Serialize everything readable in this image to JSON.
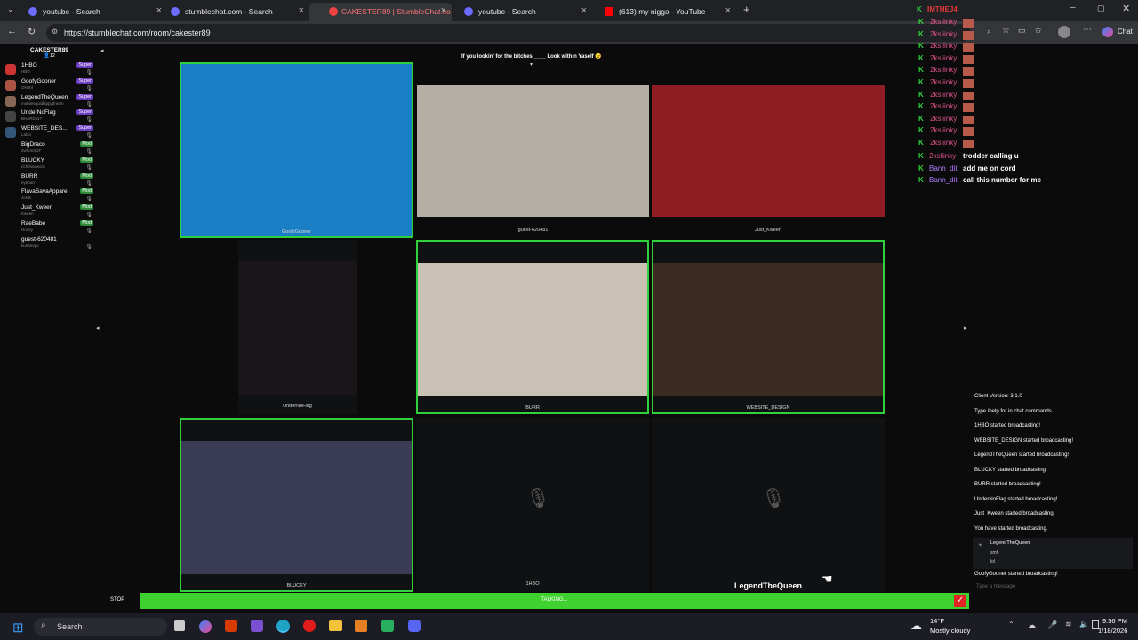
{
  "browser": {
    "tabs": [
      {
        "title": "youtube - Search",
        "fav": "#6c6cff"
      },
      {
        "title": "stumblechat.com - Search",
        "fav": "#6c6cff"
      },
      {
        "title": "CAKESTER89 | StumbleChat.co",
        "fav": "#e44"
      },
      {
        "title": "youtube - Search",
        "fav": "#6c6cff"
      },
      {
        "title": "(613) my nigga - YouTube",
        "fav": "#f00"
      }
    ],
    "url": "https://stumblechat.com/room/cakester89",
    "chat_button": "Chat"
  },
  "room": {
    "name": "CAKESTER89",
    "count": "12",
    "topic": "If you lookin' for the bitches ____ Look within Yaself 😉"
  },
  "users": [
    {
      "name": "1HBO",
      "sub": "HBO",
      "badge": "Super",
      "type": "super",
      "icon": "#c33"
    },
    {
      "name": "GoofyGooner",
      "sub": "ONIIIII",
      "badge": "Super",
      "type": "super",
      "icon": "#a54"
    },
    {
      "name": "LegendTheQueen",
      "sub": "mobilesquidhippydream",
      "badge": "Super",
      "type": "super",
      "icon": "#865"
    },
    {
      "name": "UnderNoFlag",
      "sub": "BHARD117",
      "badge": "Super",
      "type": "super",
      "icon": "#444"
    },
    {
      "name": "WEBSITE_DES...",
      "sub": "LaDa",
      "badge": "Super",
      "type": "super",
      "icon": "#357"
    },
    {
      "name": "BigDraco",
      "sub": "2whore$2F",
      "badge": "Mod",
      "type": "mod",
      "icon": ""
    },
    {
      "name": "BLUCKY",
      "sub": "richthisaword",
      "badge": "Mod",
      "type": "mod",
      "icon": ""
    },
    {
      "name": "BURR",
      "sub": "eyeburr",
      "badge": "Mod",
      "type": "mod",
      "icon": ""
    },
    {
      "name": "FlavaSavaApparel",
      "sub": "Jords",
      "badge": "Mod",
      "type": "mod",
      "icon": ""
    },
    {
      "name": "Just_Kween",
      "sub": "Kween",
      "badge": "Mod",
      "type": "mod",
      "icon": ""
    },
    {
      "name": "RaeBabe",
      "sub": "Honey",
      "badge": "Mod",
      "type": "mod",
      "icon": ""
    },
    {
      "name": "guest-620481",
      "sub": "kurlamqlo",
      "badge": "",
      "type": "",
      "icon": ""
    }
  ],
  "tiles": [
    {
      "label": "GoofyGooner",
      "on": true,
      "bg": "#1a7fc4",
      "mic": false
    },
    {
      "label": "guest-620481",
      "on": false,
      "bg": "#b4aea4",
      "mic": false
    },
    {
      "label": "Just_Kween",
      "on": false,
      "bg": "#8e1c22",
      "mic": false
    },
    {
      "label": "UnderNoFlag",
      "on": false,
      "bg": "#1a1518",
      "mic": false
    },
    {
      "label": "BURR",
      "on": true,
      "bg": "#c9c2b4",
      "mic": false
    },
    {
      "label": "WEBSITE_DESIGN",
      "on": true,
      "bg": "#3a2a22",
      "mic": false
    },
    {
      "label": "BLUCKY",
      "on": true,
      "bg": "#3a3c56",
      "mic": false
    },
    {
      "label": "1HBO",
      "on": false,
      "bg": "#0f1113",
      "mic": true
    },
    {
      "label": "LegendTheQueen",
      "on": false,
      "bg": "#0f1113",
      "mic": true
    }
  ],
  "overlay": {
    "header": "IMTHEJ4",
    "spam_name": "2ksliinky",
    "lines": [
      {
        "name": "2ksliinky",
        "text": "trodder calling u"
      },
      {
        "name": "Bann_dit",
        "text": "add me on cord"
      },
      {
        "name": "Bann_dit",
        "text": "call this number for me"
      }
    ]
  },
  "chat_log": {
    "messages": [
      "Client Version: 3.1.0",
      "Type /help for in chat commands.",
      "1HBO started broadcasting!",
      "WEBSITE_DESIGN started broadcasting!",
      "LegendTheQueen started broadcasting!",
      "BLUCKY started broadcasting!",
      "BURR started broadcasting!",
      "UnderNoFlag started broadcasting!",
      "Just_Kween started broadcasting!",
      "You have started broadcasting."
    ],
    "bubble": {
      "name": "LegendTheQueen",
      "lines": [
        "smh",
        "lol"
      ]
    },
    "last": "GoofyGooner started broadcasting!",
    "placeholder": "Type a message"
  },
  "controls": {
    "stop": "STOP",
    "talking": "TALKING..."
  },
  "taskbar": {
    "search": "Search",
    "weather_temp": "14°F",
    "weather_desc": "Mostly cloudy",
    "time": "9:56 PM",
    "date": "1/18/2026"
  }
}
